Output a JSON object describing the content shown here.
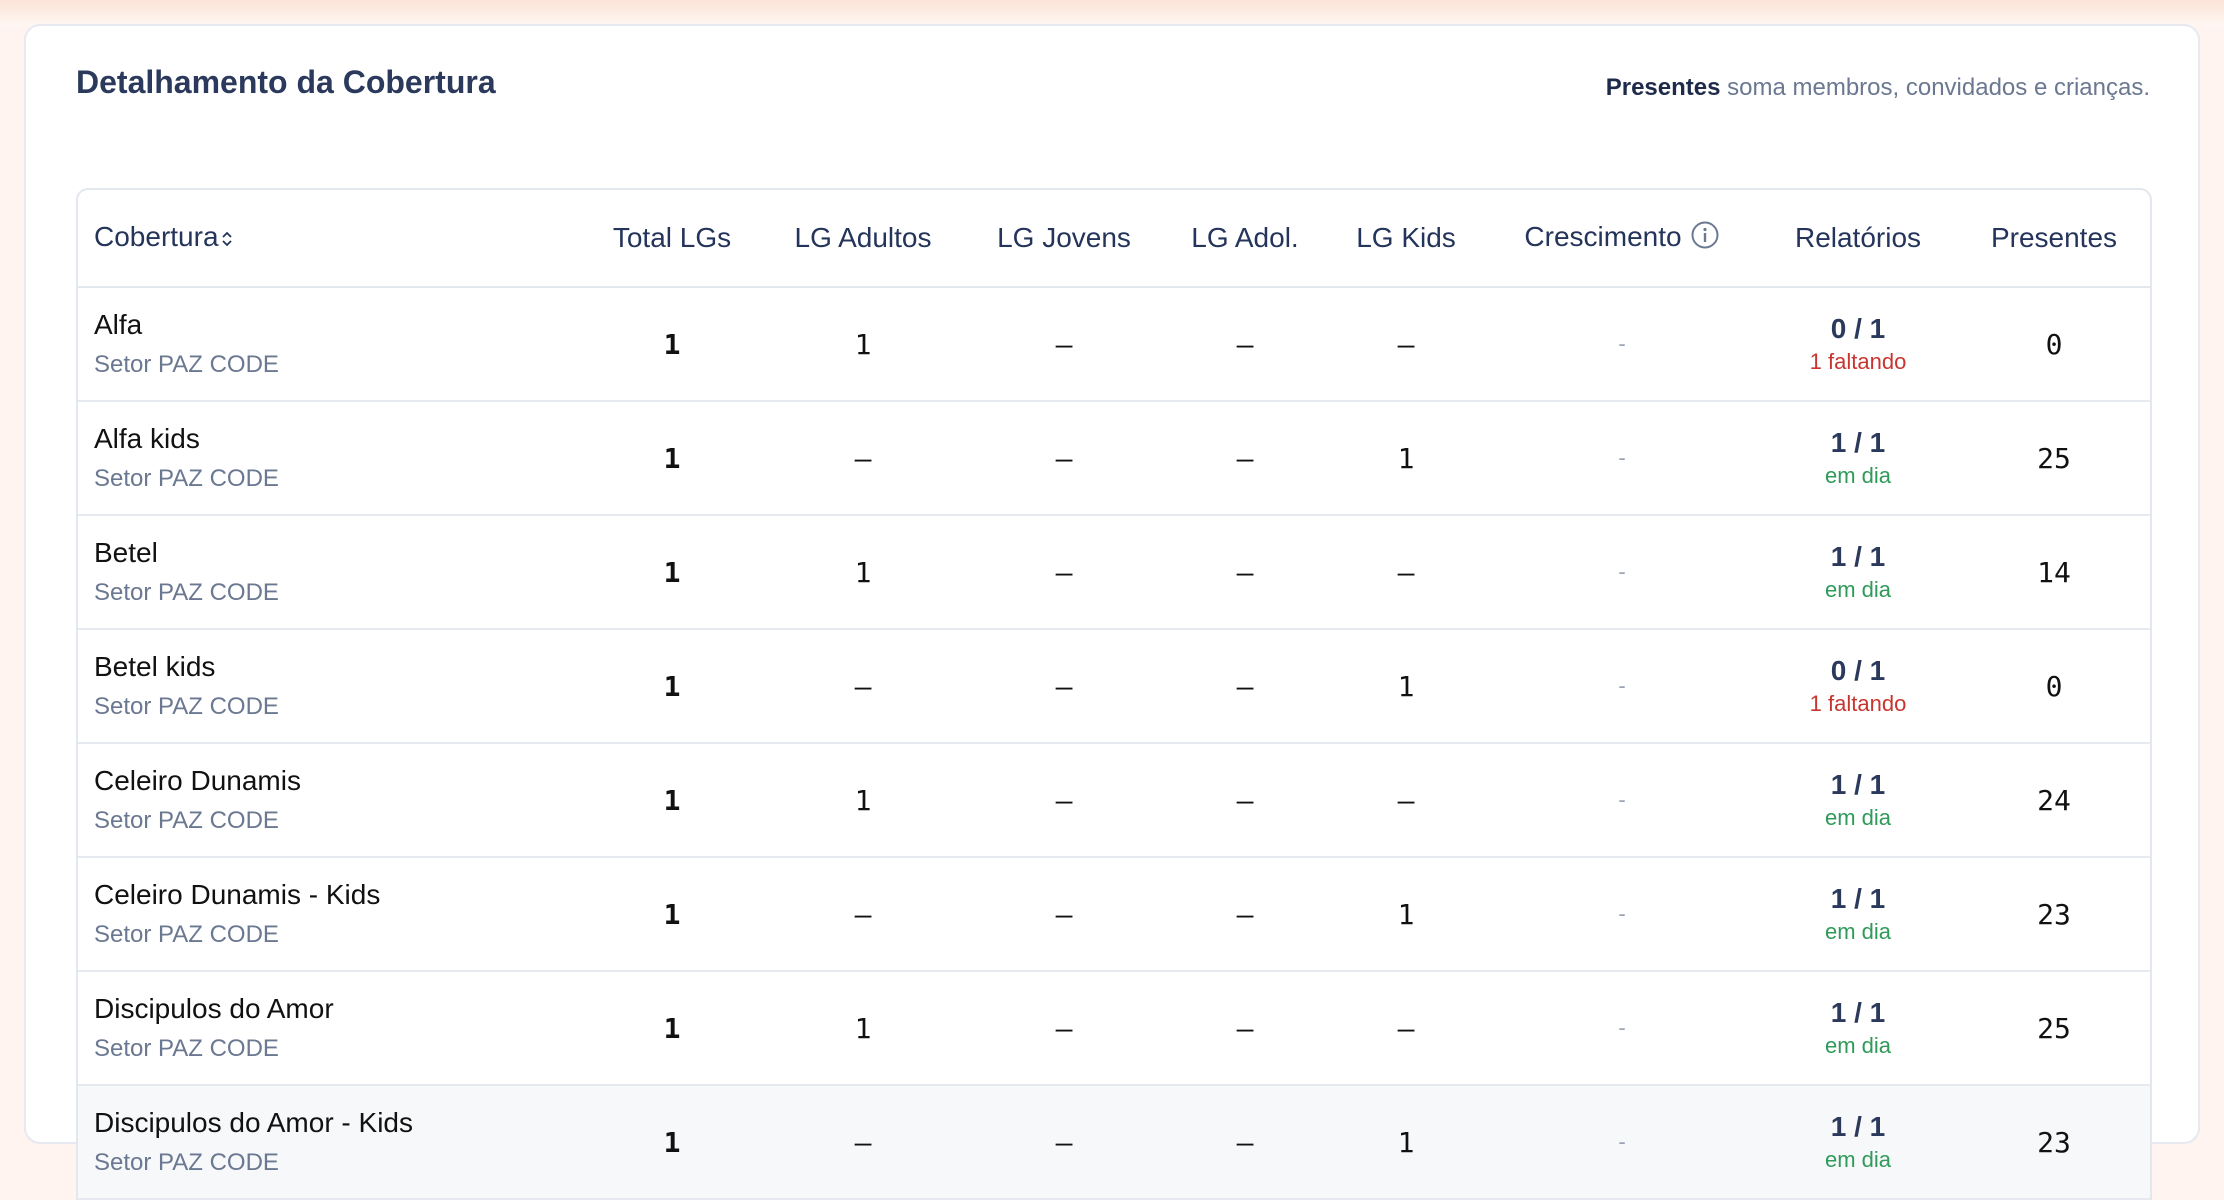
{
  "header": {
    "title": "Detalhamento da Cobertura",
    "note_bold": "Presentes",
    "note_rest": "soma membros, convidados e crianças."
  },
  "columns": {
    "cobertura": "Cobertura",
    "total": "Total LGs",
    "adultos": "LG Adultos",
    "jovens": "LG Jovens",
    "adol": "LG Adol.",
    "kids": "LG Kids",
    "crescimento": "Crescimento",
    "relatorios": "Relatórios",
    "presentes": "Presentes"
  },
  "icons": {
    "sort": "sort-icon",
    "info": "info-icon"
  },
  "rows": [
    {
      "name": "Alfa",
      "sector": "Setor PAZ CODE",
      "total": "1",
      "adultos": "1",
      "jovens": "–",
      "adol": "–",
      "kids": "–",
      "crescimento": "-",
      "rel": "0 / 1",
      "rel_status": "1 faltando",
      "presentes": "0"
    },
    {
      "name": "Alfa kids",
      "sector": "Setor PAZ CODE",
      "total": "1",
      "adultos": "–",
      "jovens": "–",
      "adol": "–",
      "kids": "1",
      "crescimento": "-",
      "rel": "1 / 1",
      "rel_status": "em dia",
      "presentes": "25"
    },
    {
      "name": "Betel",
      "sector": "Setor PAZ CODE",
      "total": "1",
      "adultos": "1",
      "jovens": "–",
      "adol": "–",
      "kids": "–",
      "crescimento": "-",
      "rel": "1 / 1",
      "rel_status": "em dia",
      "presentes": "14"
    },
    {
      "name": "Betel kids",
      "sector": "Setor PAZ CODE",
      "total": "1",
      "adultos": "–",
      "jovens": "–",
      "adol": "–",
      "kids": "1",
      "crescimento": "-",
      "rel": "0 / 1",
      "rel_status": "1 faltando",
      "presentes": "0"
    },
    {
      "name": "Celeiro Dunamis",
      "sector": "Setor PAZ CODE",
      "total": "1",
      "adultos": "1",
      "jovens": "–",
      "adol": "–",
      "kids": "–",
      "crescimento": "-",
      "rel": "1 / 1",
      "rel_status": "em dia",
      "presentes": "24"
    },
    {
      "name": "Celeiro Dunamis - Kids",
      "sector": "Setor PAZ CODE",
      "total": "1",
      "adultos": "–",
      "jovens": "–",
      "adol": "–",
      "kids": "1",
      "crescimento": "-",
      "rel": "1 / 1",
      "rel_status": "em dia",
      "presentes": "23"
    },
    {
      "name": "Discipulos do Amor",
      "sector": "Setor PAZ CODE",
      "total": "1",
      "adultos": "1",
      "jovens": "–",
      "adol": "–",
      "kids": "–",
      "crescimento": "-",
      "rel": "1 / 1",
      "rel_status": "em dia",
      "presentes": "25"
    },
    {
      "name": "Discipulos do Amor - Kids",
      "sector": "Setor PAZ CODE",
      "total": "1",
      "adultos": "–",
      "jovens": "–",
      "adol": "–",
      "kids": "1",
      "crescimento": "-",
      "rel": "1 / 1",
      "rel_status": "em dia",
      "presentes": "23"
    }
  ],
  "colors": {
    "bad": "#c8352f",
    "ok": "#2f9a5a",
    "title": "#2b3a5c"
  }
}
